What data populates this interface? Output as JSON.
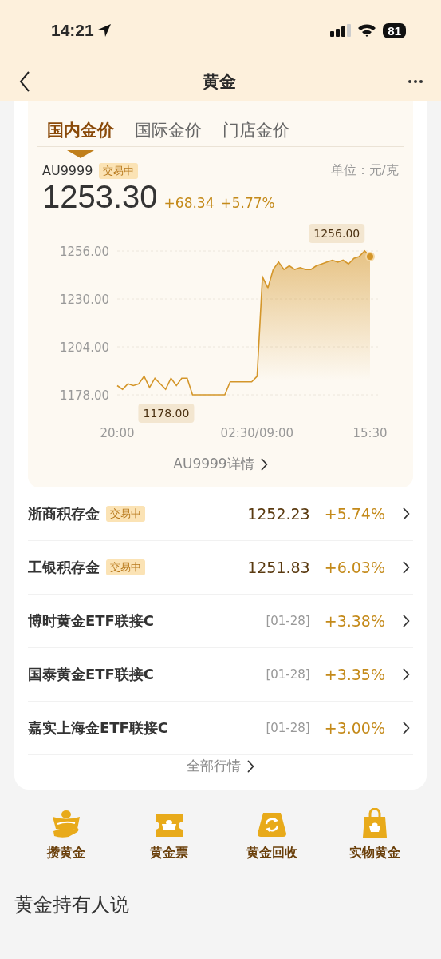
{
  "status_bar": {
    "time": "14:21",
    "battery": "81"
  },
  "nav": {
    "title": "黄金"
  },
  "tabs": [
    {
      "label": "国内金价",
      "selected": true
    },
    {
      "label": "国际金价",
      "selected": false
    },
    {
      "label": "门店金价",
      "selected": false
    }
  ],
  "quote": {
    "code": "AU9999",
    "badge": "交易中",
    "unit": "单位：元/克",
    "price": "1253.30",
    "change": "+68.34",
    "percent": "+5.77%"
  },
  "chart_data": {
    "type": "area",
    "categories": [
      "20:00",
      null,
      null,
      null,
      null,
      null,
      null,
      null,
      null,
      null,
      null,
      null,
      null,
      null,
      null,
      null,
      null,
      null,
      null,
      null,
      null,
      null,
      null,
      null,
      null,
      null,
      "02:30/09:00",
      null,
      null,
      null,
      null,
      null,
      null,
      null,
      null,
      null,
      null,
      null,
      null,
      null,
      null,
      null,
      null,
      null,
      null,
      null,
      null,
      "15:30"
    ],
    "series": [
      {
        "color": "#d4962a",
        "values": [
          1183,
          1181,
          1184,
          1183,
          1184,
          1188,
          1182,
          1187,
          1184,
          1181,
          1187,
          1183,
          1187,
          1187,
          1178,
          1178,
          1178,
          1178,
          1178,
          1178,
          1178,
          1185,
          1185,
          1185,
          1185,
          1185,
          1188,
          1242,
          1236,
          1246,
          1250,
          1246,
          1248,
          1246,
          1247,
          1246,
          1246,
          1248,
          1249,
          1250,
          1251,
          1250,
          1251,
          1249,
          1252,
          1253,
          1256,
          1253
        ]
      }
    ],
    "ylim": [
      1178,
      1256
    ],
    "yticks": [
      {
        "value": 1256,
        "label": "1256.00"
      },
      {
        "value": 1230,
        "label": "1230.00"
      },
      {
        "value": 1204,
        "label": "1204.00"
      },
      {
        "value": 1178,
        "label": "1178.00"
      }
    ],
    "annotations": [
      "1256.00",
      "1178.00"
    ]
  },
  "detail_link": "AU9999详情",
  "products": [
    {
      "kind": "quote",
      "name": "浙商积存金",
      "badge": "交易中",
      "price": "1252.23",
      "change": "+5.74%"
    },
    {
      "kind": "quote",
      "name": "工银积存金",
      "badge": "交易中",
      "price": "1251.83",
      "change": "+6.03%"
    },
    {
      "kind": "fund",
      "name": "博时黄金ETF联接C",
      "date": "[01-28]",
      "change": "+3.38%"
    },
    {
      "kind": "fund",
      "name": "国泰黄金ETF联接C",
      "date": "[01-28]",
      "change": "+3.35%"
    },
    {
      "kind": "fund",
      "name": "嘉实上海金ETF联接C",
      "date": "[01-28]",
      "change": "+3.00%"
    }
  ],
  "all_link": "全部行情",
  "shortcuts": [
    {
      "kind": "save",
      "label": "攒黄金"
    },
    {
      "kind": "ticket",
      "label": "黄金票"
    },
    {
      "kind": "recycle",
      "label": "黄金回收"
    },
    {
      "kind": "shop",
      "label": "实物黄金"
    }
  ],
  "section_title": "黄金持有人说"
}
